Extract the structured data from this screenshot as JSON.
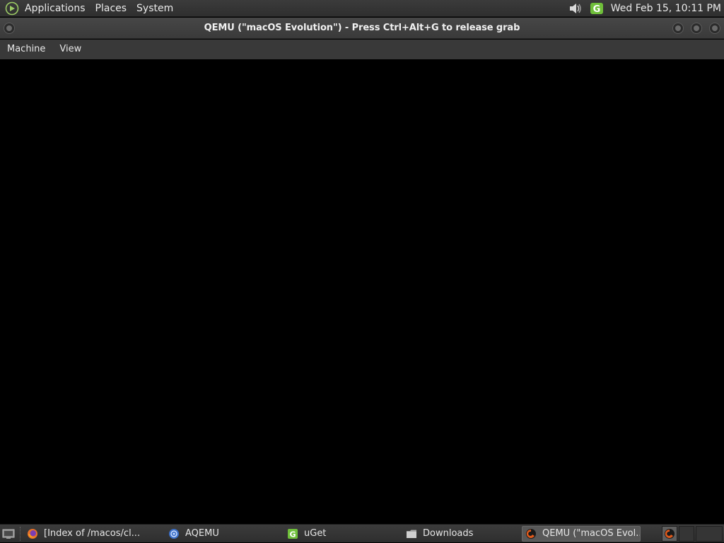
{
  "top_panel": {
    "menus": [
      "Applications",
      "Places",
      "System"
    ],
    "clock": "Wed Feb 15, 10:11 PM",
    "tray_icons": [
      "volume-icon",
      "uget-icon"
    ]
  },
  "window": {
    "title": "QEMU (\"macOS Evolution\") - Press Ctrl+Alt+G to release grab",
    "menu": [
      "Machine",
      "View"
    ]
  },
  "taskbar": {
    "tasks": [
      {
        "label": "[Index of /macos/cl...",
        "icon": "firefox-icon",
        "active": false
      },
      {
        "label": "AQEMU",
        "icon": "aqemu-icon",
        "active": false
      },
      {
        "label": "uGet",
        "icon": "uget-icon",
        "active": false
      },
      {
        "label": "Downloads",
        "icon": "folder-icon",
        "active": false
      },
      {
        "label": "QEMU (\"macOS Evol...",
        "icon": "qemu-icon",
        "active": true
      }
    ]
  },
  "colors": {
    "panel": "#333333",
    "titlebar": "#404040",
    "screen": "#000000",
    "accent_green": "#6fbf3a",
    "qemu_orange": "#e05a1c"
  }
}
